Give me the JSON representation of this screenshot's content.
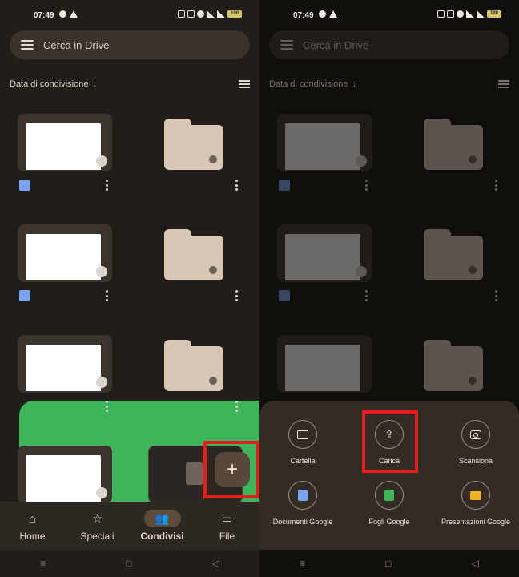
{
  "status_bar": {
    "time": "07:49",
    "battery": "100"
  },
  "search": {
    "placeholder": "Cerca in Drive"
  },
  "sort": {
    "label": "Data di condivisione",
    "arrow": "↓"
  },
  "fab": {
    "label": "+"
  },
  "bottom_nav": [
    {
      "label": "Home",
      "icon": "home-icon",
      "glyph": "⌂"
    },
    {
      "label": "Speciali",
      "icon": "star-icon",
      "glyph": "☆"
    },
    {
      "label": "Condivisi",
      "icon": "people-icon",
      "glyph": "👥"
    },
    {
      "label": "File",
      "icon": "folder-icon",
      "glyph": "▭"
    }
  ],
  "system_nav": {
    "menu": "≡",
    "home": "□",
    "back": "◁"
  },
  "create_sheet": {
    "options": [
      {
        "label": "Cartella",
        "icon": "folder-icon"
      },
      {
        "label": "Carica",
        "icon": "upload-icon",
        "glyph": "⇪"
      },
      {
        "label": "Scansiona",
        "icon": "camera-icon"
      },
      {
        "label": "Documenti Google",
        "icon": "google-docs-icon"
      },
      {
        "label": "Fogli Google",
        "icon": "google-sheets-icon"
      },
      {
        "label": "Presentazioni Google",
        "icon": "google-slides-icon"
      }
    ]
  },
  "colors": {
    "highlight": "#e41d1d",
    "docs_blue": "#7aa4f0",
    "sheets_green": "#3fb45b",
    "slides_yellow": "#efb226"
  }
}
